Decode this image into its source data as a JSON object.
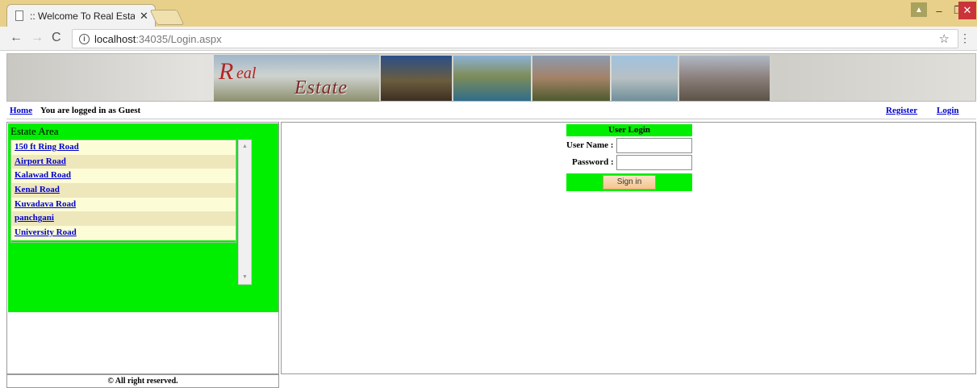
{
  "browser": {
    "tab_title": ":: Welcome To Real Estate",
    "tab_close": "✕",
    "url_host": "localhost",
    "url_path": ":34035/Login.aspx",
    "win_user": "▲",
    "win_min": "–",
    "win_max": "❐",
    "win_close": "✕"
  },
  "banner": {
    "logo_r": "R",
    "logo_eal": "eal",
    "logo_estate": "Estate"
  },
  "nav": {
    "home": "Home",
    "guest_status": "You are logged in as Guest",
    "register": "Register",
    "login": "Login"
  },
  "estate_area": {
    "title": "Estate Area",
    "items": [
      {
        "label": "150 ft Ring Road"
      },
      {
        "label": "Airport Road"
      },
      {
        "label": "Kalawad Road"
      },
      {
        "label": "Kenal Road"
      },
      {
        "label": "Kuvadava Road"
      },
      {
        "label": "panchgani"
      },
      {
        "label": "University Road"
      }
    ]
  },
  "login": {
    "title": "User Login",
    "username_label": "User Name :",
    "password_label": "Password   :",
    "username_value": "",
    "password_value": "",
    "signin_label": "Sign in"
  },
  "footer": {
    "copyright": "© All right reserved."
  },
  "colors": {
    "accent_green": "#00ee00",
    "link_blue": "#0000cc",
    "titlebar": "#e8d08a"
  }
}
